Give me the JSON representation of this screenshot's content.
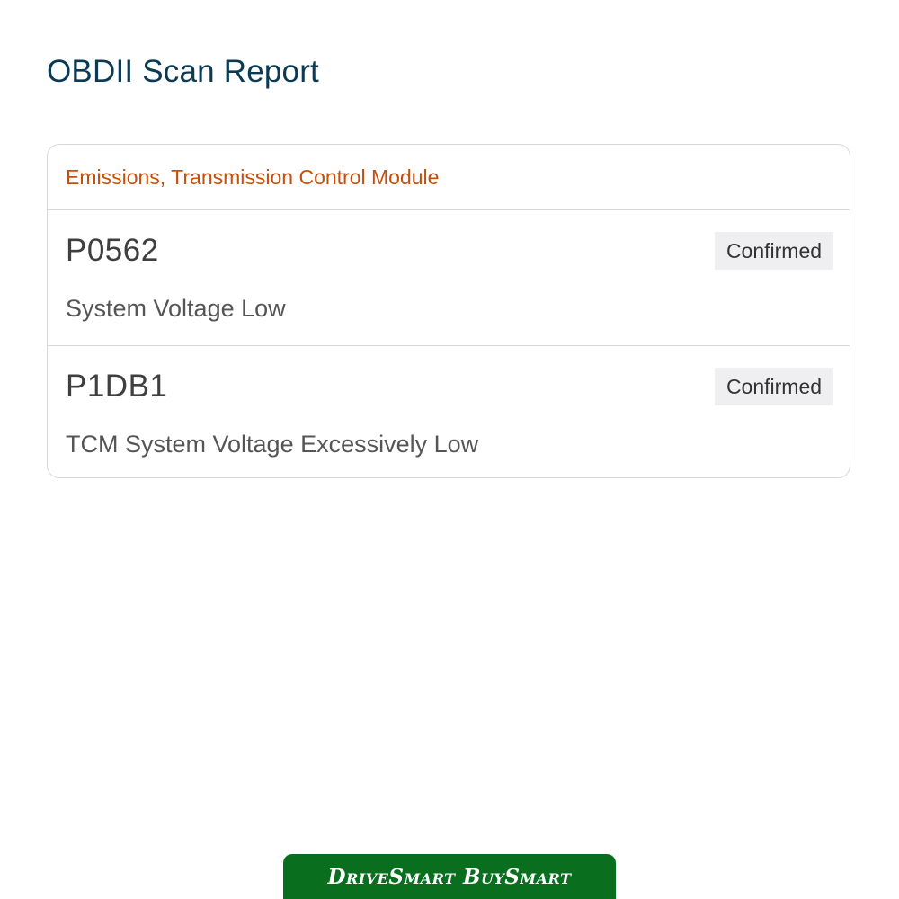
{
  "page": {
    "title": "OBDII Scan Report"
  },
  "module": {
    "name": "Emissions, Transmission Control Module"
  },
  "codes": [
    {
      "code": "P0562",
      "status": "Confirmed",
      "description": "System Voltage Low"
    },
    {
      "code": "P1DB1",
      "status": "Confirmed",
      "description": "TCM System Voltage Excessively Low"
    }
  ],
  "footer": {
    "brand": "DriveSmart BuySmart"
  },
  "colors": {
    "title": "#0c3a52",
    "module_header": "#c4500d",
    "badge_bg": "#efeff2",
    "banner": "#0a6e1f"
  }
}
